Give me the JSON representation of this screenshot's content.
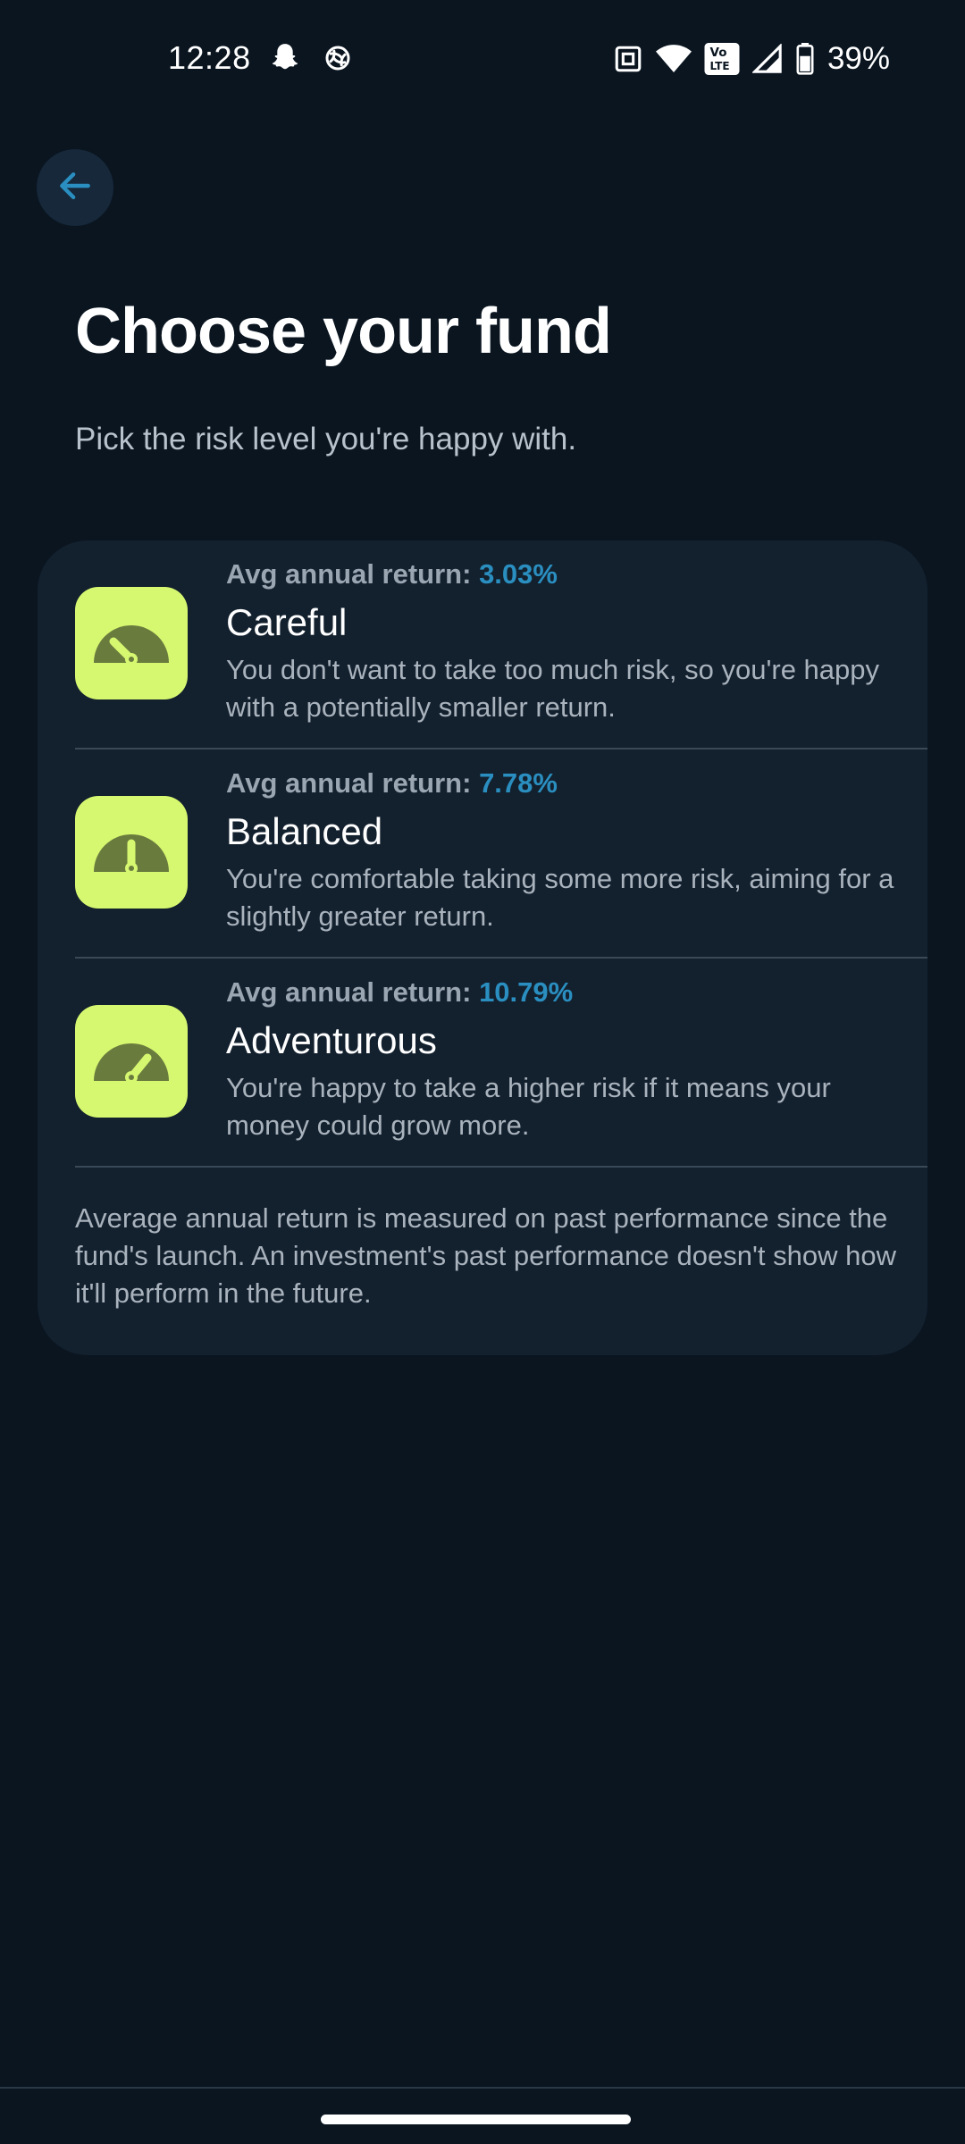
{
  "status_bar": {
    "time": "12:28",
    "battery_percent": "39%",
    "icons": [
      "snapchat-icon",
      "sync-app-icon",
      "nfc-icon",
      "wifi-icon",
      "volte-icon",
      "signal-icon",
      "battery-icon"
    ],
    "volte_label_top": "Vo",
    "volte_label_bottom": "LTE"
  },
  "header": {
    "back_icon": "arrow-left-icon",
    "title": "Choose your fund",
    "subtitle": "Pick the risk level you're happy with."
  },
  "funds": [
    {
      "return_label": "Avg annual return:",
      "return_value": "3.03%",
      "name": "Careful",
      "description": "You don't want to take too much risk, so you're happy with a potentially smaller return.",
      "icon": "speedometer-low-icon"
    },
    {
      "return_label": "Avg annual return:",
      "return_value": "7.78%",
      "name": "Balanced",
      "description": "You're comfortable taking some more risk, aiming for a slightly greater return.",
      "icon": "speedometer-medium-icon"
    },
    {
      "return_label": "Avg annual return:",
      "return_value": "10.79%",
      "name": "Adventurous",
      "description": "You're happy to take a higher risk if it means your money could grow more.",
      "icon": "speedometer-high-icon"
    }
  ],
  "disclaimer": "Average annual return is measured on past performance since the fund's launch. An investment's past performance doesn't show how it'll perform in the future.",
  "colors": {
    "background": "#0a1520",
    "card": "#13202e",
    "accent_blue": "#2a8fc0",
    "icon_tile": "#d6f870",
    "gauge": "#6a7b3e"
  }
}
